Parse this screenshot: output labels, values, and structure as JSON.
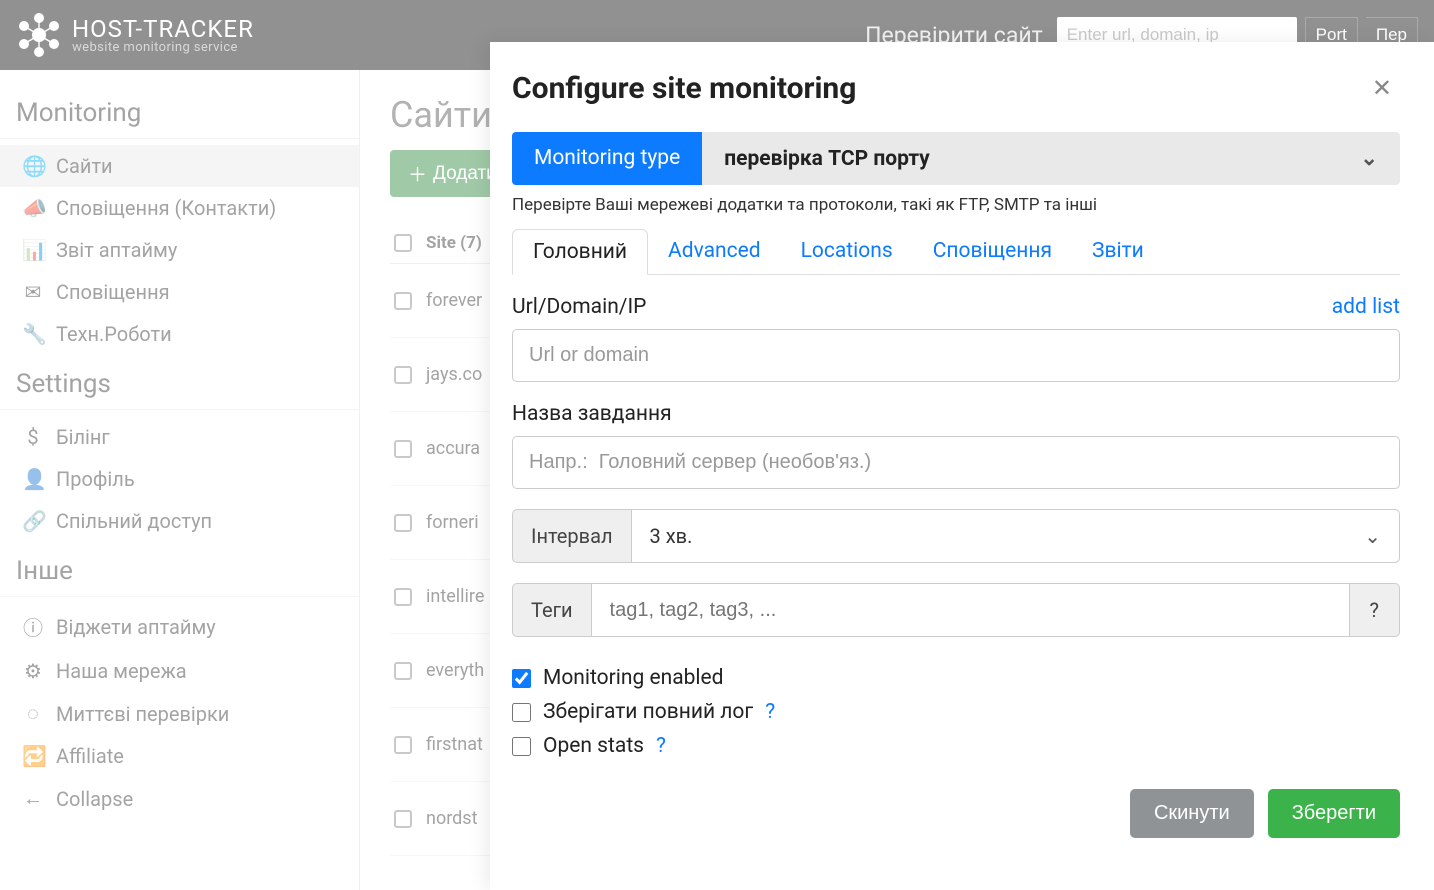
{
  "topbar": {
    "brand_line1": "HOST-TRACKER",
    "brand_line2": "website monitoring service",
    "check_label": "Перевірити сайт",
    "url_placeholder": "Enter url, domain, ip",
    "port_btn": "Port",
    "per_btn": "Пер"
  },
  "sidebar": {
    "group1": "Monitoring",
    "items1": [
      {
        "label": "Сайти"
      },
      {
        "label": "Сповіщення (Контакти)"
      },
      {
        "label": "Звіт аптайму"
      },
      {
        "label": "Сповіщення"
      },
      {
        "label": "Техн.Роботи"
      }
    ],
    "group2": "Settings",
    "items2": [
      {
        "label": "Білінг"
      },
      {
        "label": "Профіль"
      },
      {
        "label": "Спільний доступ"
      }
    ],
    "group3": "Інше",
    "items3": [
      {
        "label": "Віджети аптайму"
      },
      {
        "label": "Наша мережа"
      },
      {
        "label": "Миттєві перевірки"
      },
      {
        "label": "Affiliate"
      },
      {
        "label": "Collapse"
      }
    ]
  },
  "main": {
    "title": "Сайти",
    "add_btn": "Додати",
    "header": "Site (7)",
    "rows": [
      "forever",
      "jays.co",
      "accura",
      "forneri",
      "intellire",
      "everyth",
      "firstnat",
      "nordst"
    ]
  },
  "modal": {
    "title": "Configure site monitoring",
    "type_label": "Monitoring type",
    "type_value": "перевірка TCP порту",
    "type_hint": "Перевірте Ваші мережеві додатки та протоколи, такі як FTP, SMTP та інші",
    "tabs": [
      "Головний",
      "Advanced",
      "Locations",
      "Сповіщення",
      "Звіти"
    ],
    "url_label": "Url/Domain/IP",
    "add_list": "add list",
    "url_placeholder": "Url or domain",
    "name_label": "Назва завдання",
    "name_placeholder": "Напр.:  Головний сервер (необов'яз.)",
    "interval_label": "Інтервал",
    "interval_value": "3 хв.",
    "tags_label": "Теги",
    "tags_placeholder": "tag1, tag2, tag3, ...",
    "tags_help": "?",
    "check_enabled": "Monitoring enabled",
    "check_fulllog": "Зберігати повний лог",
    "check_openstats": "Open stats",
    "q": "?",
    "reset_btn": "Скинути",
    "save_btn": "Зберегти"
  }
}
